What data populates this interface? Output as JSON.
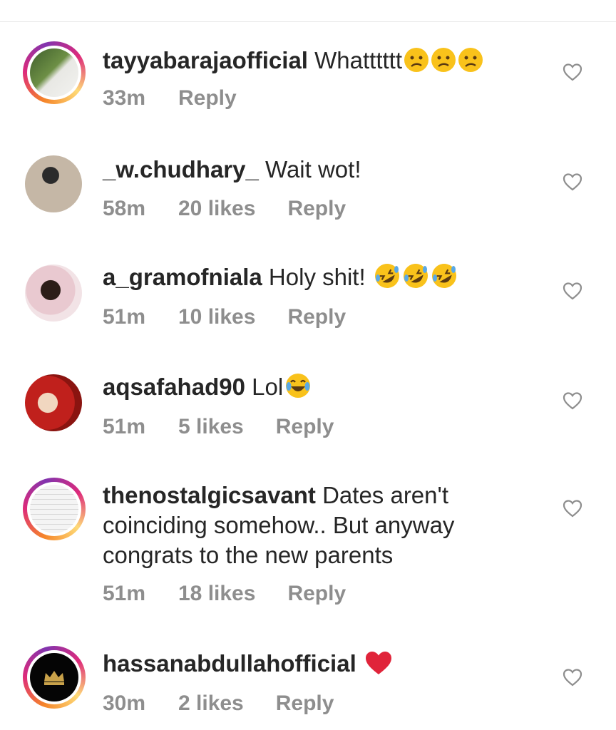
{
  "comments": [
    {
      "username": "tayyabarajaofficial",
      "text": "Whatttttt",
      "emoji": [
        "confused-face",
        "confused-face",
        "confused-face"
      ],
      "time": "33m",
      "likes": "",
      "reply": "Reply",
      "ring": true
    },
    {
      "username": "_w.chudhary_",
      "text": "Wait wot!",
      "emoji": [],
      "time": "58m",
      "likes": "20 likes",
      "reply": "Reply",
      "ring": false
    },
    {
      "username": "a_gramofniala",
      "text": "Holy shit!",
      "emoji": [
        "rofl-face",
        "rofl-face",
        "rofl-face"
      ],
      "time": "51m",
      "likes": "10 likes",
      "reply": "Reply",
      "ring": false
    },
    {
      "username": "aqsafahad90",
      "text": "Lol",
      "emoji": [
        "joy-face"
      ],
      "time": "51m",
      "likes": "5 likes",
      "reply": "Reply",
      "ring": false
    },
    {
      "username": "thenostalgicsavant",
      "text": "Dates aren't coinciding somehow.. But anyway congrats to the new parents",
      "emoji": [],
      "time": "51m",
      "likes": "18 likes",
      "reply": "Reply",
      "ring": true
    },
    {
      "username": "hassanabdullahofficial",
      "text": "",
      "emoji": [
        "red-heart"
      ],
      "time": "30m",
      "likes": "2 likes",
      "reply": "Reply",
      "ring": true
    }
  ],
  "colors": {
    "text": "#262626",
    "meta": "#8e8e8e",
    "ring_start": "#f58529",
    "ring_mid": "#dd2a7b",
    "heart_emoji": "#e0243a",
    "emoji_face": "#f9c21b"
  },
  "icons": {
    "like": "heart-outline-icon"
  }
}
